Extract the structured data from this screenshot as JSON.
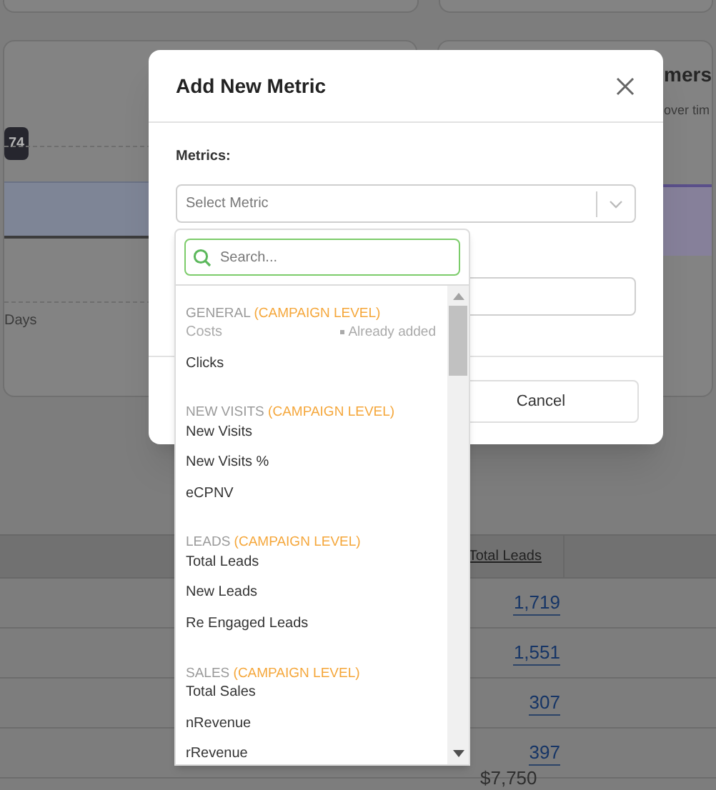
{
  "background": {
    "chart_tooltip": "74",
    "axis_label": "Days",
    "card_title": "mers",
    "card_subtitle": "over tim",
    "table": {
      "column": "Total Leads",
      "rows": [
        "1,719",
        "1,551",
        "307",
        "397"
      ],
      "partial_cell": "$7,750"
    }
  },
  "dialog": {
    "title": "Add New Metric",
    "field_label": "Metrics:",
    "select": {
      "placeholder": "Select Metric"
    },
    "buttons": [
      {
        "label": "Cancel"
      }
    ]
  },
  "dropdown": {
    "search": {
      "placeholder": "Search..."
    },
    "groups": [
      {
        "name": "GENERAL",
        "level": "(CAMPAIGN LEVEL)",
        "items": [
          {
            "label": "Costs",
            "disabled": true,
            "note": "Already added"
          },
          {
            "label": "Clicks",
            "disabled": false
          }
        ]
      },
      {
        "name": "NEW VISITS",
        "level": "(CAMPAIGN LEVEL)",
        "items": [
          {
            "label": "New Visits",
            "disabled": false
          },
          {
            "label": "New Visits %",
            "disabled": false
          },
          {
            "label": "eCPNV",
            "disabled": false
          }
        ]
      },
      {
        "name": "LEADS",
        "level": "(CAMPAIGN LEVEL)",
        "items": [
          {
            "label": "Total Leads",
            "disabled": false
          },
          {
            "label": "New Leads",
            "disabled": false
          },
          {
            "label": "Re Engaged Leads",
            "disabled": false
          }
        ]
      },
      {
        "name": "SALES",
        "level": "(CAMPAIGN LEVEL)",
        "items": [
          {
            "label": "Total Sales",
            "disabled": false
          },
          {
            "label": "nRevenue",
            "disabled": false
          },
          {
            "label": "rRevenue",
            "disabled": false
          }
        ]
      }
    ]
  }
}
